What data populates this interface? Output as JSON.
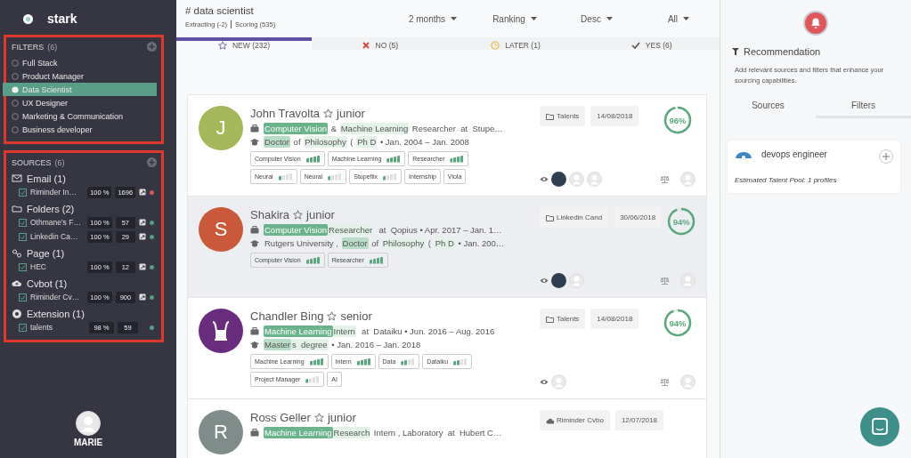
{
  "brand": "stark",
  "filters": {
    "title": "FILTERS",
    "count": "(6)",
    "items": [
      {
        "label": "Full Stack",
        "selected": false
      },
      {
        "label": "Product Manager",
        "selected": false
      },
      {
        "label": "Data Scientist",
        "selected": true
      },
      {
        "label": "UX Designer",
        "selected": false
      },
      {
        "label": "Marketing & Communication",
        "selected": false
      },
      {
        "label": "Business developer",
        "selected": false
      }
    ]
  },
  "sources": {
    "title": "SOURCES",
    "count": "(6)",
    "groups": [
      {
        "kind": "email",
        "label": "Email (1)",
        "items": [
          {
            "name": "Riminder In…",
            "checked": true,
            "percent": "100 %",
            "count": "1696",
            "export": true,
            "color": "#e0575b"
          }
        ]
      },
      {
        "kind": "folder",
        "label": "Folders (2)",
        "items": [
          {
            "name": "Othmane's F…",
            "checked": true,
            "percent": "100 %",
            "count": "57",
            "export": true,
            "color": "#5b9e88"
          },
          {
            "name": "Linkedin Ca…",
            "checked": true,
            "percent": "100 %",
            "count": "29",
            "export": true,
            "color": "#5b9e88"
          }
        ]
      },
      {
        "kind": "page",
        "label": "Page (1)",
        "items": [
          {
            "name": "HEC",
            "checked": true,
            "percent": "100 %",
            "count": "12",
            "export": true,
            "color": "#5b9e88"
          }
        ]
      },
      {
        "kind": "cvbot",
        "label": "Cvbot (1)",
        "items": [
          {
            "name": "Riminder Cv…",
            "checked": true,
            "percent": "100 %",
            "count": "900",
            "export": true,
            "color": "#5b9e88"
          }
        ]
      },
      {
        "kind": "extension",
        "label": "Extension (1)",
        "items": [
          {
            "name": "talents",
            "checked": true,
            "percent": "98 %",
            "count": "59",
            "export": false,
            "color": "#5b9e88"
          }
        ]
      }
    ]
  },
  "user": {
    "name": "MARIE"
  },
  "header": {
    "title": "# data scientist",
    "status": [
      "Extracting (-2)",
      "Scoring (535)"
    ],
    "dropdowns": [
      "2 months",
      "Ranking",
      "Desc",
      "All"
    ]
  },
  "tabs": [
    {
      "kind": "star",
      "label": "NEW (232)",
      "selected": true
    },
    {
      "kind": "cross",
      "label": "NO (5)",
      "selected": false
    },
    {
      "kind": "clock",
      "label": "LATER (1)",
      "selected": false
    },
    {
      "kind": "check",
      "label": "YES (6)",
      "selected": false
    }
  ],
  "candidates": [
    {
      "avatar": {
        "kind": "letter",
        "text": "J",
        "color": "#a4b85a"
      },
      "name": "John Travolta",
      "seniority": "junior",
      "hovered": false,
      "job": [
        {
          "t": "Computer Vision",
          "kind": "strong"
        },
        {
          "t": " & "
        },
        {
          "t": "Machine Learning",
          "kind": "light"
        },
        {
          "t": " Researcher  at  Stupe…"
        }
      ],
      "education": [
        {
          "t": "Doctor",
          "kind": "medium"
        },
        {
          "t": " of "
        },
        {
          "t": "Philosophy",
          "kind": "light"
        },
        {
          "t": " ( "
        },
        {
          "t": "Ph D",
          "kind": "light"
        },
        {
          "t": " • Jan. 2004 – Jan. 2008"
        }
      ],
      "skills": [
        {
          "label": "Computer Vision",
          "level": 1
        },
        {
          "label": "Machine Learning",
          "level": 1
        },
        {
          "label": "Researcher",
          "level": 1
        },
        {
          "label": "Neural",
          "level": 0.25
        },
        {
          "label": "Neural",
          "level": 0.25
        },
        {
          "label": "Stupeflix",
          "level": 0.25
        },
        {
          "label": "Internship"
        },
        {
          "label": "Viola"
        }
      ],
      "source": {
        "kind": "folder",
        "label": "Talents"
      },
      "date": "14/08/2018",
      "score": {
        "label": "96%",
        "level": 0.96
      },
      "viewers": [
        {
          "kind": "photo"
        },
        {
          "kind": "blank"
        },
        {
          "kind": "blank"
        }
      ]
    },
    {
      "avatar": {
        "kind": "letter",
        "text": "S",
        "color": "#c9593a"
      },
      "name": "Shakira",
      "seniority": "junior",
      "hovered": true,
      "job": [
        {
          "t": "Computer Vision",
          "kind": "strong"
        },
        {
          "t": "Researcher",
          "kind": "light"
        },
        {
          "t": "  at  Qopius • Apr. 2017 – Jan. 1…"
        }
      ],
      "education": [
        {
          "t": "Rutgers University , "
        },
        {
          "t": "Doctor",
          "kind": "medium"
        },
        {
          "t": " of "
        },
        {
          "t": "Philosophy",
          "kind": "light"
        },
        {
          "t": " ( "
        },
        {
          "t": "Ph D",
          "kind": "light"
        },
        {
          "t": " • Jan. 200…"
        }
      ],
      "skills": [
        {
          "label": "Computer Vision",
          "level": 1
        },
        {
          "label": "Researcher",
          "level": 1
        }
      ],
      "source": {
        "kind": "folder",
        "label": "Linkedin Cand"
      },
      "date": "30/06/2018",
      "score": {
        "label": "94%",
        "level": 0.94
      },
      "viewers": [
        {
          "kind": "photo"
        },
        {
          "kind": "blank"
        }
      ]
    },
    {
      "avatar": {
        "kind": "lyre",
        "color": "#6a2d7e"
      },
      "name": "Chandler Bing",
      "seniority": "senior",
      "hovered": false,
      "job": [
        {
          "t": "Machine Learning",
          "kind": "strong"
        },
        {
          "t": "Intern",
          "kind": "light"
        },
        {
          "t": "  at  Dataiku • Jun. 2016 – Aug. 2016"
        }
      ],
      "education": [
        {
          "t": "Master",
          "kind": "medium"
        },
        {
          "t": "s  degree",
          "kind": "light"
        },
        {
          "t": " • Jan. 2016 – Jan. 2018"
        }
      ],
      "skills": [
        {
          "label": "Machine Learning",
          "level": 1
        },
        {
          "label": "Intern",
          "level": 1
        },
        {
          "label": "Data",
          "level": 0.5
        },
        {
          "label": "Dataiku",
          "level": 0.5
        },
        {
          "label": "Project Manager",
          "level": 0.25
        },
        {
          "label": "AI"
        }
      ],
      "source": {
        "kind": "folder",
        "label": "Talents"
      },
      "date": "14/08/2018",
      "score": {
        "label": "94%",
        "level": 0.94
      },
      "viewers": [
        {
          "kind": "blank"
        }
      ]
    },
    {
      "avatar": {
        "kind": "letter",
        "text": "R",
        "color": "#7f8c89"
      },
      "name": "Ross Geller",
      "seniority": "junior",
      "hovered": false,
      "job": [
        {
          "t": "Machine Learning",
          "kind": "strong"
        },
        {
          "t": "Research",
          "kind": "light"
        },
        {
          "t": " Intern , Laboratory  at  Hubert C…"
        }
      ],
      "source": {
        "kind": "cloud",
        "label": "Riminder Cvbo"
      },
      "date": "12/07/2018"
    }
  ],
  "panel": {
    "title": "Recommendation",
    "description": "Add relevant sources and filters that enhance your sourcing capabilities.",
    "tabs": [
      {
        "label": "Sources",
        "selected": false
      },
      {
        "label": "Filters",
        "selected": true
      }
    ],
    "card": {
      "title": "devops engineer",
      "note": "Estimated Talent Pool: 1 profiles"
    }
  }
}
